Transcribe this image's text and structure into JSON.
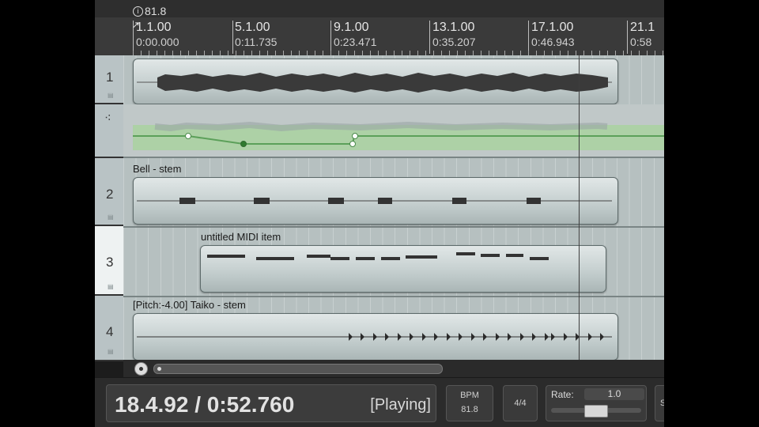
{
  "ruler": {
    "tempo_marker": "81.8",
    "marks": [
      {
        "bar": "1.1.00",
        "time": "0:00.000"
      },
      {
        "bar": "5.1.00",
        "time": "0:11.735"
      },
      {
        "bar": "9.1.00",
        "time": "0:23.471"
      },
      {
        "bar": "13.1.00",
        "time": "0:35.207"
      },
      {
        "bar": "17.1.00",
        "time": "0:46.943"
      },
      {
        "bar": "21.1",
        "time": "0:58"
      }
    ]
  },
  "tracks": [
    {
      "number": "1",
      "item_name": ""
    },
    {
      "number": "",
      "item_name": "",
      "envelope": true
    },
    {
      "number": "2",
      "item_name": "Bell - stem"
    },
    {
      "number": "3",
      "item_name": "untitled MIDI item"
    },
    {
      "number": "4",
      "item_name": "[Pitch:-4.00] Taiko - stem"
    }
  ],
  "transport": {
    "position": "18.4.92 / 0:52.760",
    "state": "[Playing]",
    "bpm_label": "BPM",
    "bpm_value": "81.8",
    "time_signature": "4/4",
    "rate_label": "Rate:",
    "rate_value": "1.0",
    "edge_label": "S"
  },
  "icons": {
    "envelope": "envelope-points-icon",
    "tempo": "tempo-marker-icon",
    "scroll": "scroll-home-icon"
  }
}
